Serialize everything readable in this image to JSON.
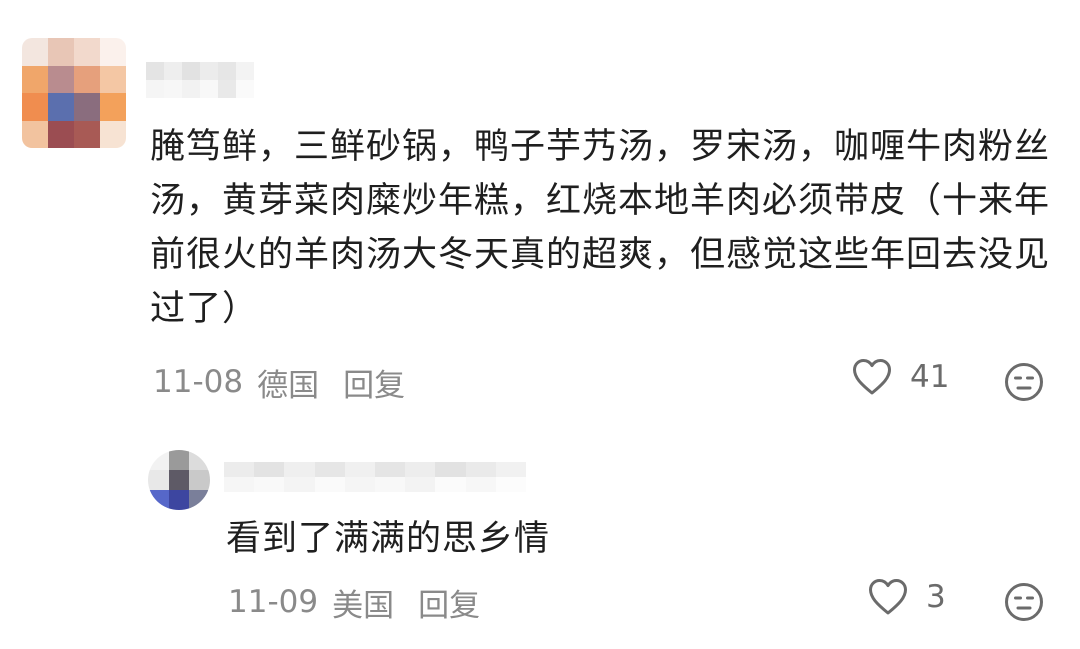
{
  "comments": [
    {
      "avatar_icon": "pixelated-avatar",
      "text": "腌笃鲜，三鲜砂锅，鸭子芋艿汤，罗宋汤，咖喱牛肉粉丝汤，黄芽菜肉糜炒年糕，红烧本地羊肉必须带皮（十来年前很火的羊肉汤大冬天真的超爽，但感觉这些年回去没见过了）",
      "date": "11-08",
      "location": "德国",
      "reply_label": "回复",
      "like_icon": "heart-outline-icon",
      "like_count": "41",
      "dislike_icon": "neutral-face-icon"
    },
    {
      "avatar_icon": "pixelated-avatar",
      "text": "看到了满满的思乡情",
      "date": "11-09",
      "location": "美国",
      "reply_label": "回复",
      "like_icon": "heart-outline-icon",
      "like_count": "3",
      "dislike_icon": "neutral-face-icon"
    }
  ],
  "colors": {
    "text": "#1f1f1f",
    "meta": "#8a8a8a",
    "icon": "#6b6b6b",
    "background": "#ffffff"
  }
}
